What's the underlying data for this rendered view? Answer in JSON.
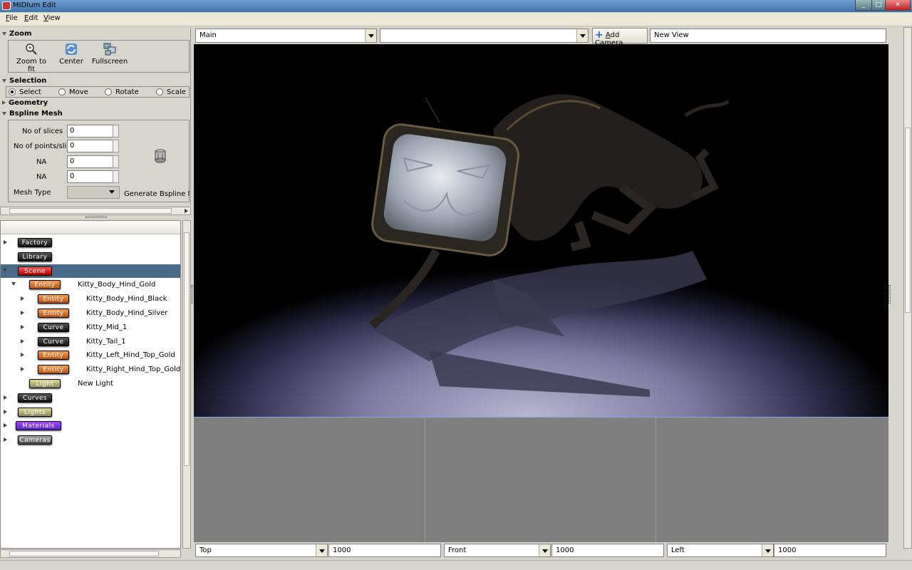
{
  "window": {
    "title": "MIDIum Edit",
    "controls": [
      "_",
      "□",
      "✕"
    ]
  },
  "menu": [
    {
      "key": "F",
      "rest": "ile"
    },
    {
      "key": "E",
      "rest": "dit"
    },
    {
      "key": "V",
      "rest": "iew"
    }
  ],
  "zoom": {
    "title": "Zoom",
    "buttons": [
      {
        "label": "Zoom to fit",
        "icon": "magnifier-icon"
      },
      {
        "label": "Center",
        "icon": "center-icon"
      },
      {
        "label": "Fullscreen",
        "icon": "fullscreen-icon"
      }
    ]
  },
  "selection": {
    "title": "Selection",
    "modes": [
      "Select",
      "Move",
      "Rotate",
      "Scale"
    ],
    "selected": "Select"
  },
  "geometry": {
    "title": "Geometry"
  },
  "bspline": {
    "title": "Bspline Mesh",
    "fields": [
      {
        "label": "No of slices",
        "value": "0"
      },
      {
        "label": "No of points/slice",
        "value": "0"
      },
      {
        "label": "NA",
        "value": "0"
      },
      {
        "label": "NA",
        "value": "0"
      }
    ],
    "mesh_type_label": "Mesh Type",
    "mesh_type_value": "",
    "generate_label": "Generate Bspline Me"
  },
  "tree": {
    "items": [
      {
        "badge": "Factory",
        "color": "black",
        "indent": 0,
        "expander": "right",
        "text": ""
      },
      {
        "badge": "Library",
        "color": "black",
        "indent": 0,
        "expander": "none",
        "text": ""
      },
      {
        "badge": "Scene",
        "color": "red",
        "indent": 0,
        "expander": "down",
        "text": "",
        "selected": true
      },
      {
        "badge": "Entity",
        "color": "orange",
        "indent": 1,
        "expander": "down",
        "text": "Kitty_Body_Hind_Gold"
      },
      {
        "badge": "Entity",
        "color": "orange",
        "indent": 2,
        "expander": "right",
        "text": "Kitty_Body_Hind_Black"
      },
      {
        "badge": "Entity",
        "color": "orange",
        "indent": 2,
        "expander": "right",
        "text": "Kitty_Body_Hind_Silver"
      },
      {
        "badge": "Curve",
        "color": "black",
        "indent": 2,
        "expander": "right",
        "text": "Kitty_Mid_1"
      },
      {
        "badge": "Curve",
        "color": "black",
        "indent": 2,
        "expander": "right",
        "text": "Kitty_Tail_1"
      },
      {
        "badge": "Entity",
        "color": "orange",
        "indent": 2,
        "expander": "right",
        "text": "Kitty_Left_Hind_Top_Gold"
      },
      {
        "badge": "Entity",
        "color": "orange",
        "indent": 2,
        "expander": "right",
        "text": "Kitty_Right_Hind_Top_Gold"
      },
      {
        "badge": "Light",
        "color": "yellow",
        "indent": 1,
        "expander": "none",
        "text": "New Light"
      },
      {
        "badge": "Curves",
        "color": "black",
        "indent": 0,
        "expander": "right",
        "text": ""
      },
      {
        "badge": "Lights",
        "color": "yellow",
        "indent": 0,
        "expander": "right",
        "text": ""
      },
      {
        "badge": "Materials",
        "color": "purple",
        "indent": 0,
        "expander": "right",
        "text": ""
      },
      {
        "badge": "Cameras",
        "color": "gray",
        "indent": 0,
        "expander": "right",
        "text": ""
      }
    ]
  },
  "viewbar": {
    "view_select": "Main",
    "camera_select": "",
    "add_camera_label": "Add Camera",
    "add_camera_key": "A",
    "view_name": "New View"
  },
  "bottom": [
    {
      "view": "Top",
      "value": "1000"
    },
    {
      "view": "Front",
      "value": "1000"
    },
    {
      "view": "Left",
      "value": "1000"
    }
  ],
  "colors": {
    "selected_row": "#4a6b87",
    "viewport_floor": "#b8b6d0"
  }
}
